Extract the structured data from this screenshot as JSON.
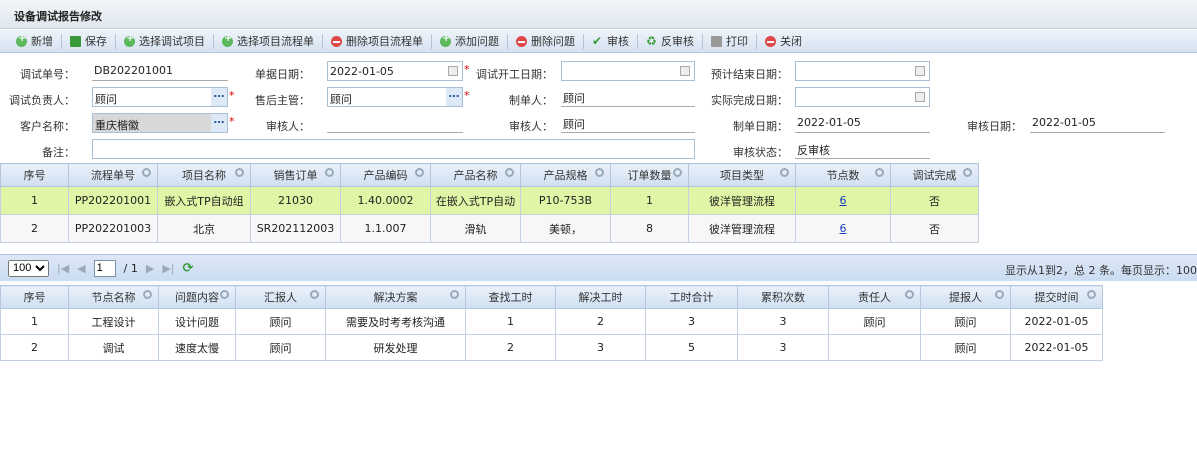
{
  "window": {
    "title": "设备调试报告修改"
  },
  "toolbar": [
    {
      "label": "新增",
      "icon": "add-icon"
    },
    {
      "label": "保存",
      "icon": "save-icon"
    },
    {
      "label": "选择调试项目",
      "icon": "add-icon"
    },
    {
      "label": "选择项目流程单",
      "icon": "add-icon"
    },
    {
      "label": "删除项目流程单",
      "icon": "delete-icon"
    },
    {
      "label": "添加问题",
      "icon": "add-icon"
    },
    {
      "label": "删除问题",
      "icon": "delete-icon"
    },
    {
      "label": "审核",
      "icon": "check-icon"
    },
    {
      "label": "反审核",
      "icon": "uncheck-icon"
    },
    {
      "label": "打印",
      "icon": "print-icon"
    },
    {
      "label": "关闭",
      "icon": "close-icon"
    }
  ],
  "form": {
    "debug_no": {
      "label": "调试单号：",
      "value": "DB202201001"
    },
    "doc_date": {
      "label": "单据日期：",
      "value": "2022-01-05"
    },
    "start_date": {
      "label": "调试开工日期：",
      "value": ""
    },
    "planned_end": {
      "label": "预计结束日期：",
      "value": ""
    },
    "owner": {
      "label": "调试负责人：",
      "value": "顾问"
    },
    "supervisor": {
      "label": "售后主管：",
      "value": "顾问"
    },
    "creator": {
      "label": "制单人：",
      "value": "顾问"
    },
    "actual_end": {
      "label": "实际完成日期：",
      "value": ""
    },
    "customer": {
      "label": "客户名称：",
      "value": "重庆楷徽"
    },
    "reviewer1": {
      "label": "审核人：",
      "value": ""
    },
    "reviewer2": {
      "label": "审核人：",
      "value": "顾问"
    },
    "create_date": {
      "label": "制单日期：",
      "value": "2022-01-05"
    },
    "review_date": {
      "label": "审核日期：",
      "value": "2022-01-05"
    },
    "remark": {
      "label": "备注：",
      "value": ""
    },
    "review_status": {
      "label": "审核状态：",
      "value": "反审核"
    }
  },
  "flow_grid": {
    "columns": [
      "序号",
      "流程单号",
      "项目名称",
      "销售订单",
      "产品编码",
      "产品名称",
      "产品规格",
      "订单数量",
      "项目类型",
      "节点数",
      "调试完成"
    ],
    "rows": [
      [
        "1",
        "PP202201001",
        "嵌入式TP自动组",
        "21030",
        "1.40.0002",
        "在嵌入式TP自动",
        "P10-753B",
        "1",
        "彼洋管理流程",
        "6",
        "否"
      ],
      [
        "2",
        "PP202201003",
        "北京",
        "SR202112003",
        "1.1.007",
        "滑轨",
        "美顿，",
        "8",
        "彼洋管理流程",
        "6",
        "否"
      ]
    ],
    "selected_row": 0
  },
  "pager": {
    "page_size": "100",
    "page": "1",
    "total_pages": "/ 1",
    "info": "显示从1到2，总 2 条。每页显示：100"
  },
  "issue_grid": {
    "columns": [
      "序号",
      "节点名称",
      "问题内容",
      "汇报人",
      "解决方案",
      "查找工时",
      "解决工时",
      "工时合计",
      "累积次数",
      "责任人",
      "提报人",
      "提交时间"
    ],
    "rows": [
      [
        "1",
        "工程设计",
        "设计问题",
        "顾问",
        "需要及时考考核沟通",
        "1",
        "2",
        "3",
        "3",
        "顾问",
        "顾问",
        "2022-01-05"
      ],
      [
        "2",
        "调试",
        "速度太慢",
        "顾问",
        "研发处理",
        "2",
        "3",
        "5",
        "3",
        "",
        "顾问",
        "2022-01-05"
      ]
    ]
  },
  "colors": {
    "selected_row": "#e0f5a6",
    "header": "#cfdff1",
    "required": "#dd0000"
  }
}
